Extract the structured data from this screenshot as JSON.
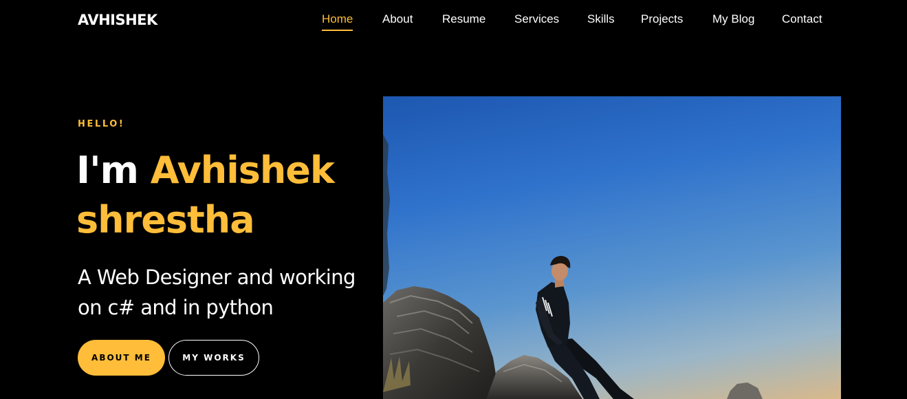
{
  "brand": {
    "name": "AVHISHEK"
  },
  "nav": {
    "items": [
      {
        "label": "Home",
        "active": true
      },
      {
        "label": "About",
        "active": false
      },
      {
        "label": "Resume",
        "active": false
      },
      {
        "label": "Services",
        "active": false
      },
      {
        "label": "Skills",
        "active": false
      },
      {
        "label": "Projects",
        "active": false
      },
      {
        "label": "My Blog",
        "active": false
      },
      {
        "label": "Contact",
        "active": false
      }
    ]
  },
  "hero": {
    "greeting": "HELLO!",
    "intro": "I'm ",
    "name": "Avhishek shrestha",
    "subtitle": "A Web Designer and working on c# and in python",
    "buttons": {
      "primary": "ABOUT ME",
      "secondary": "MY WORKS"
    },
    "photo_icon": "portrait-photo"
  },
  "colors": {
    "accent": "#ffbd39",
    "background": "#000000",
    "text": "#ffffff"
  }
}
